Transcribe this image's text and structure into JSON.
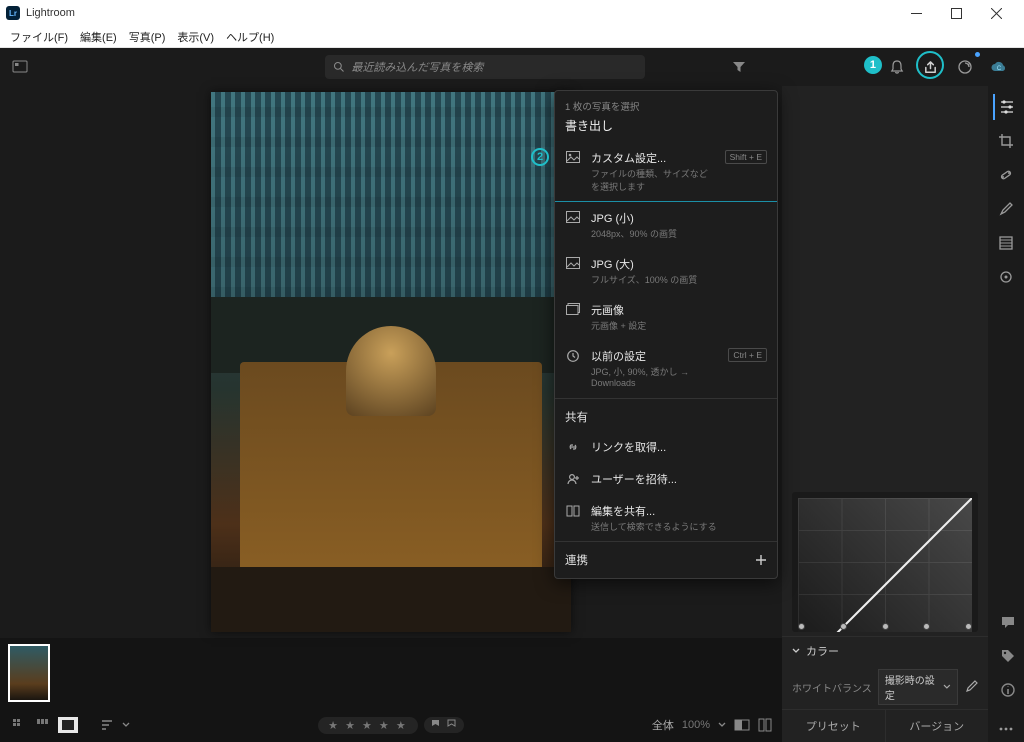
{
  "window": {
    "title": "Lightroom",
    "logo_text": "Lr"
  },
  "menubar": {
    "file": "ファイル(F)",
    "edit": "編集(E)",
    "photo": "写真(P)",
    "view": "表示(V)",
    "help": "ヘルプ(H)"
  },
  "toolbar": {
    "search_placeholder": "最近読み込んだ写真を検索",
    "marker1": "1"
  },
  "export_panel": {
    "count_text": "1 枚の写真を選択",
    "header": "書き出し",
    "marker2": "2",
    "items": {
      "custom": {
        "title": "カスタム設定...",
        "sub": "ファイルの種類、サイズなどを選択します",
        "kbd": "Shift + E"
      },
      "jpg_small": {
        "title": "JPG (小)",
        "sub": "2048px、90% の画質"
      },
      "jpg_large": {
        "title": "JPG (大)",
        "sub": "フルサイズ、100% の画質"
      },
      "original": {
        "title": "元画像",
        "sub": "元画像 + 設定"
      },
      "previous": {
        "title": "以前の設定",
        "sub": "JPG, 小, 90%, 透かし → Downloads",
        "kbd": "Ctrl + E"
      }
    },
    "share_header": "共有",
    "share_items": {
      "link": {
        "title": "リンクを取得..."
      },
      "invite": {
        "title": "ユーザーを招待..."
      },
      "edit_share": {
        "title": "編集を共有...",
        "sub": "送信して検索できるようにする"
      }
    },
    "integrations_header": "連携"
  },
  "rightpanel": {
    "color_section": "カラー",
    "wb_label": "ホワイトバランス",
    "wb_value": "撮影時の設定",
    "btn_preset": "プリセット",
    "btn_version": "バージョン"
  },
  "bottombar": {
    "fit_label": "全体",
    "zoom_value": "100%"
  }
}
